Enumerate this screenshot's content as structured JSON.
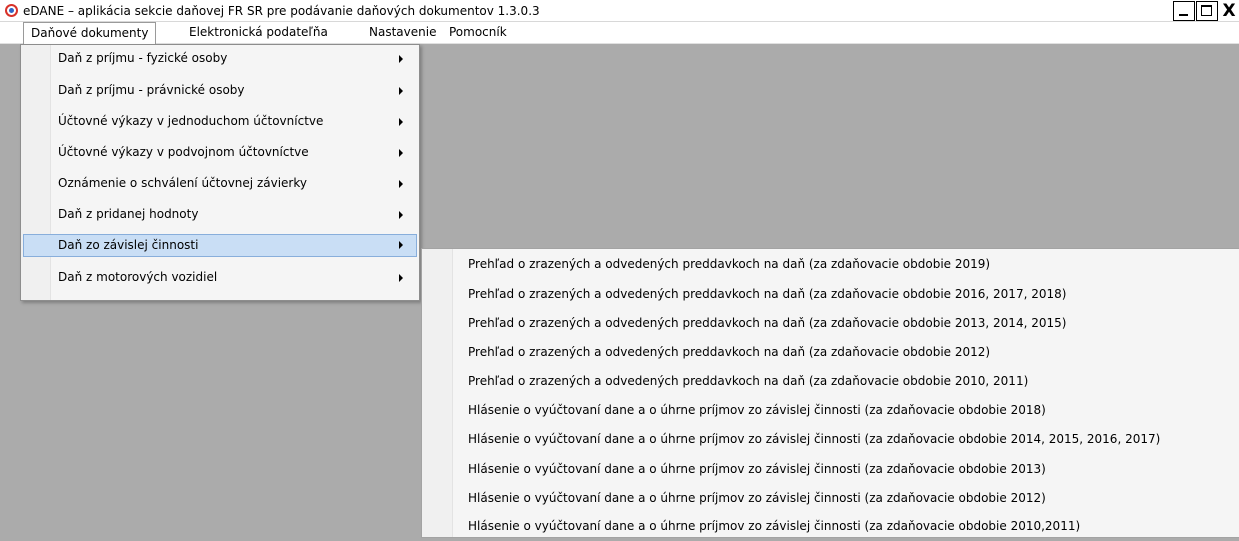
{
  "window": {
    "title": "eDANE – aplikácia sekcie daňovej FR SR pre podávanie daňových dokumentov  1.3.0.3",
    "icon": "edane-app-icon",
    "controls": {
      "minimize": "_",
      "maximize": "□",
      "close": "X"
    }
  },
  "menubar": {
    "items": [
      {
        "label": "Daňové dokumenty",
        "active": true
      },
      {
        "label": "Elektronická podateľňa",
        "active": false
      },
      {
        "label": "Nastavenie",
        "active": false
      },
      {
        "label": "Pomocník",
        "active": false
      }
    ]
  },
  "dropdown": {
    "items": [
      {
        "label": "Daň z príjmu - fyzické osoby",
        "has_submenu": true
      },
      {
        "label": "Daň z príjmu - právnické osoby",
        "has_submenu": true
      },
      {
        "label": "Účtovné výkazy v jednoduchom účtovníctve",
        "has_submenu": true
      },
      {
        "label": "Účtovné výkazy v podvojnom účtovníctve",
        "has_submenu": true
      },
      {
        "label": "Oznámenie o schválení účtovnej závierky",
        "has_submenu": true
      },
      {
        "label": "Daň z pridanej hodnoty",
        "has_submenu": true
      },
      {
        "label": "Daň zo závislej činnosti",
        "has_submenu": true,
        "highlighted": true
      },
      {
        "label": "Daň z motorových vozidiel",
        "has_submenu": true
      }
    ]
  },
  "submenu": {
    "items": [
      {
        "label": "Prehľad o zrazených a odvedených preddavkoch na daň (za zdaňovacie obdobie 2019)"
      },
      {
        "label": "Prehľad o zrazených a odvedených preddavkoch na daň (za zdaňovacie obdobie 2016, 2017, 2018)"
      },
      {
        "label": "Prehľad o zrazených a odvedených preddavkoch na daň (za zdaňovacie obdobie 2013, 2014, 2015)"
      },
      {
        "label": "Prehľad o zrazených a odvedených preddavkoch na daň (za zdaňovacie obdobie 2012)"
      },
      {
        "label": "Prehľad o zrazených a odvedených preddavkoch na daň (za zdaňovacie obdobie 2010, 2011)"
      },
      {
        "label": "Hlásenie o vyúčtovaní dane a o úhrne príjmov zo závislej činnosti (za zdaňovacie obdobie 2018)"
      },
      {
        "label": "Hlásenie o vyúčtovaní dane a o úhrne príjmov zo závislej činnosti (za zdaňovacie obdobie 2014, 2015, 2016, 2017)"
      },
      {
        "label": "Hlásenie o vyúčtovaní dane a o úhrne príjmov zo závislej činnosti (za zdaňovacie obdobie 2013)"
      },
      {
        "label": "Hlásenie o vyúčtovaní dane a o úhrne príjmov zo závislej činnosti (za zdaňovacie obdobie 2012)"
      },
      {
        "label": "Hlásenie o vyúčtovaní dane a o úhrne príjmov zo závislej činnosti (za zdaňovacie obdobie 2010,2011)"
      }
    ]
  },
  "colors": {
    "workspace_bg": "#ababab",
    "menu_bg": "#f5f5f5",
    "highlight_bg": "#c9def5",
    "highlight_border": "#88aedb"
  }
}
